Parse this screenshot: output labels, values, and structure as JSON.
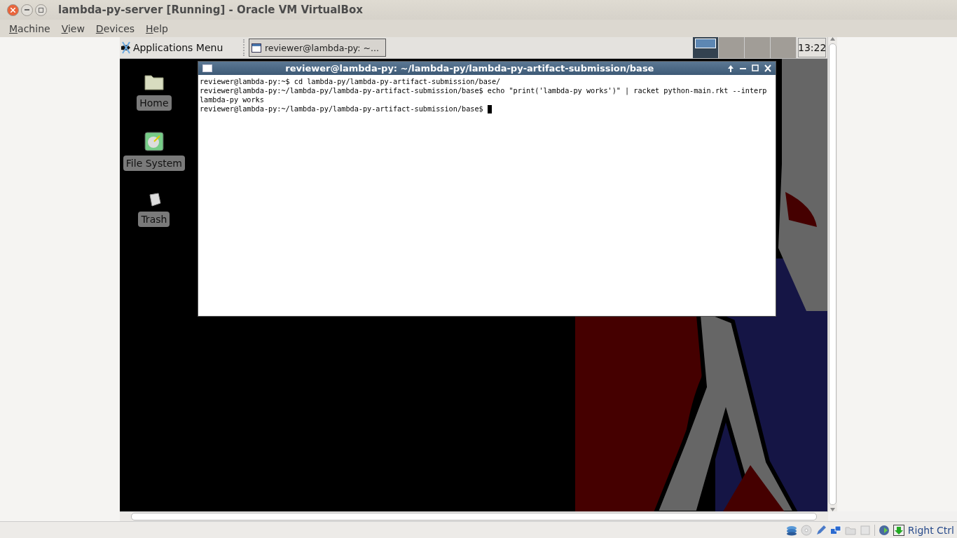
{
  "window": {
    "title": "lambda-py-server [Running] - Oracle VM VirtualBox"
  },
  "menu": [
    {
      "label": "Machine"
    },
    {
      "label": "View"
    },
    {
      "label": "Devices"
    },
    {
      "label": "Help"
    }
  ],
  "guest_panel": {
    "app_menu": "Applications Menu",
    "task": "reviewer@lambda-py: ~...",
    "workspaces": [
      {
        "selected": true
      },
      {
        "selected": false
      },
      {
        "selected": false
      },
      {
        "selected": false
      }
    ],
    "clock": "13:22"
  },
  "desktop_icons": [
    {
      "kind": "folder",
      "label": "Home"
    },
    {
      "kind": "drive",
      "label": "File System"
    },
    {
      "kind": "trash",
      "label": "Trash"
    }
  ],
  "terminal": {
    "title": "reviewer@lambda-py: ~/lambda-py/lambda-py-artifact-submission/base",
    "lines": [
      "reviewer@lambda-py:~$ cd lambda-py/lambda-py-artifact-submission/base/",
      "reviewer@lambda-py:~/lambda-py/lambda-py-artifact-submission/base$ echo \"print('lambda-py works')\" | racket python-main.rkt --interp",
      "lambda-py works",
      "reviewer@lambda-py:~/lambda-py/lambda-py-artifact-submission/base$ "
    ]
  },
  "status_bar": {
    "host_key": "Right Ctrl"
  }
}
